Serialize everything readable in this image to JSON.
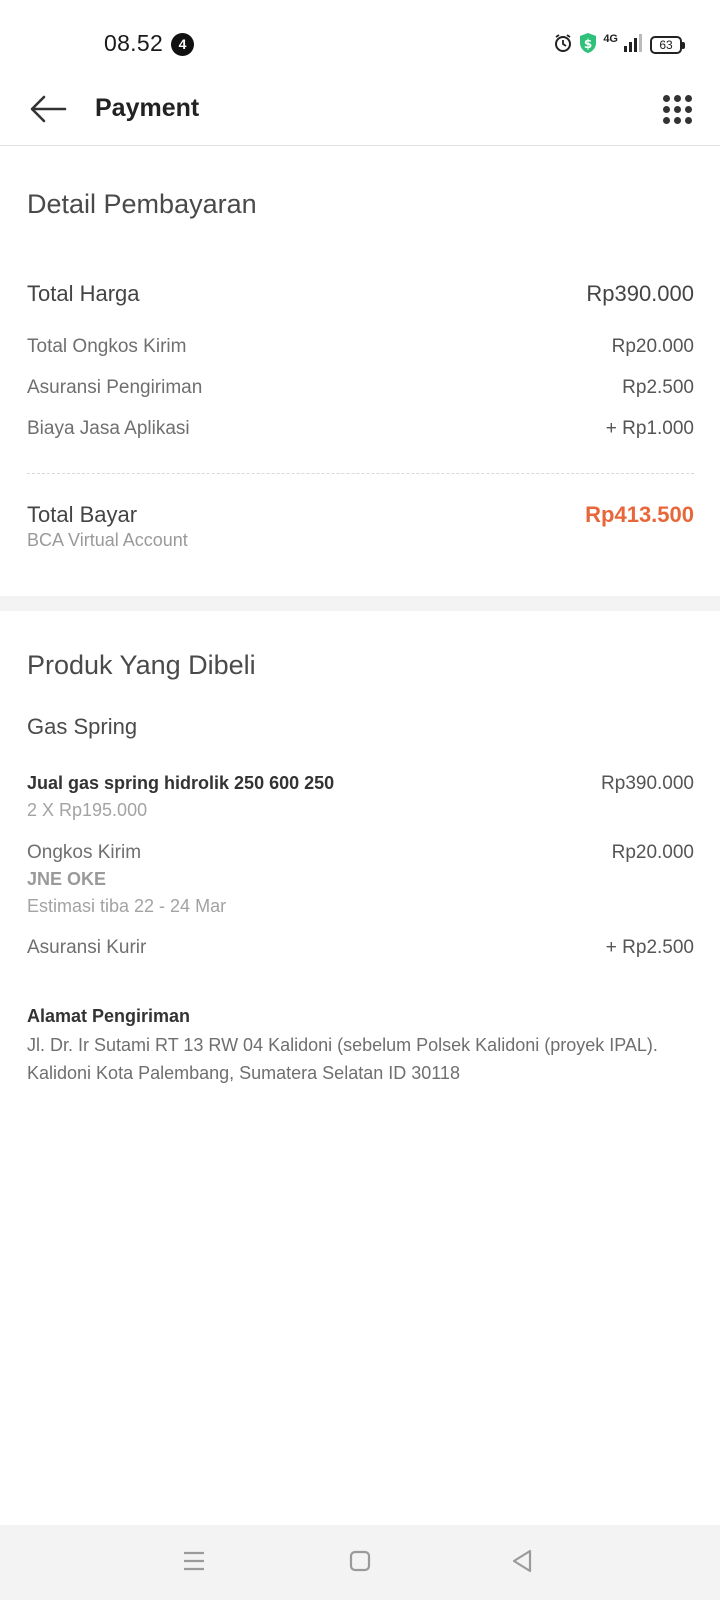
{
  "status_bar": {
    "time": "08.52",
    "notification_count": "4",
    "network": "4G",
    "battery": "63",
    "icons": [
      "alarm-icon",
      "shield-dollar-icon",
      "signal-icon",
      "battery-icon"
    ]
  },
  "header": {
    "title": "Payment",
    "back_icon": "arrow-left-icon",
    "menu_icon": "grid-menu-icon"
  },
  "payment_detail": {
    "title": "Detail Pembayaran",
    "total_harga": {
      "label": "Total Harga",
      "value": "Rp390.000"
    },
    "ongkos_kirim": {
      "label": "Total Ongkos Kirim",
      "value": "Rp20.000"
    },
    "asuransi": {
      "label": "Asuransi Pengiriman",
      "value": "Rp2.500"
    },
    "biaya_jasa": {
      "label": "Biaya Jasa Aplikasi",
      "value": "+ Rp1.000"
    },
    "total_bayar": {
      "label": "Total Bayar",
      "value": "Rp413.500",
      "method": "BCA Virtual Account"
    }
  },
  "products": {
    "title": "Produk Yang Dibeli",
    "store": "Gas Spring",
    "item": {
      "name": "Jual gas spring hidrolik 250 600 250",
      "price": "Rp390.000",
      "qty": "2 X Rp195.000"
    },
    "shipping": {
      "label": "Ongkos Kirim",
      "value": "Rp20.000",
      "courier": "JNE OKE",
      "eta": "Estimasi tiba 22 - 24 Mar"
    },
    "insurance": {
      "label": "Asuransi Kurir",
      "value": "+ Rp2.500"
    }
  },
  "address": {
    "title": "Alamat Pengiriman",
    "text": "Jl. Dr. Ir Sutami RT 13 RW 04 Kalidoni (sebelum Polsek Kalidoni (proyek IPAL). Kalidoni Kota Palembang, Sumatera Selatan ID 30118"
  },
  "colors": {
    "accent": "#e8673a",
    "text": "#4a4a4a",
    "muted": "#9a9a9a"
  },
  "nav_bar": {
    "icons": [
      "menu-lines-icon",
      "home-square-icon",
      "back-triangle-icon"
    ]
  }
}
